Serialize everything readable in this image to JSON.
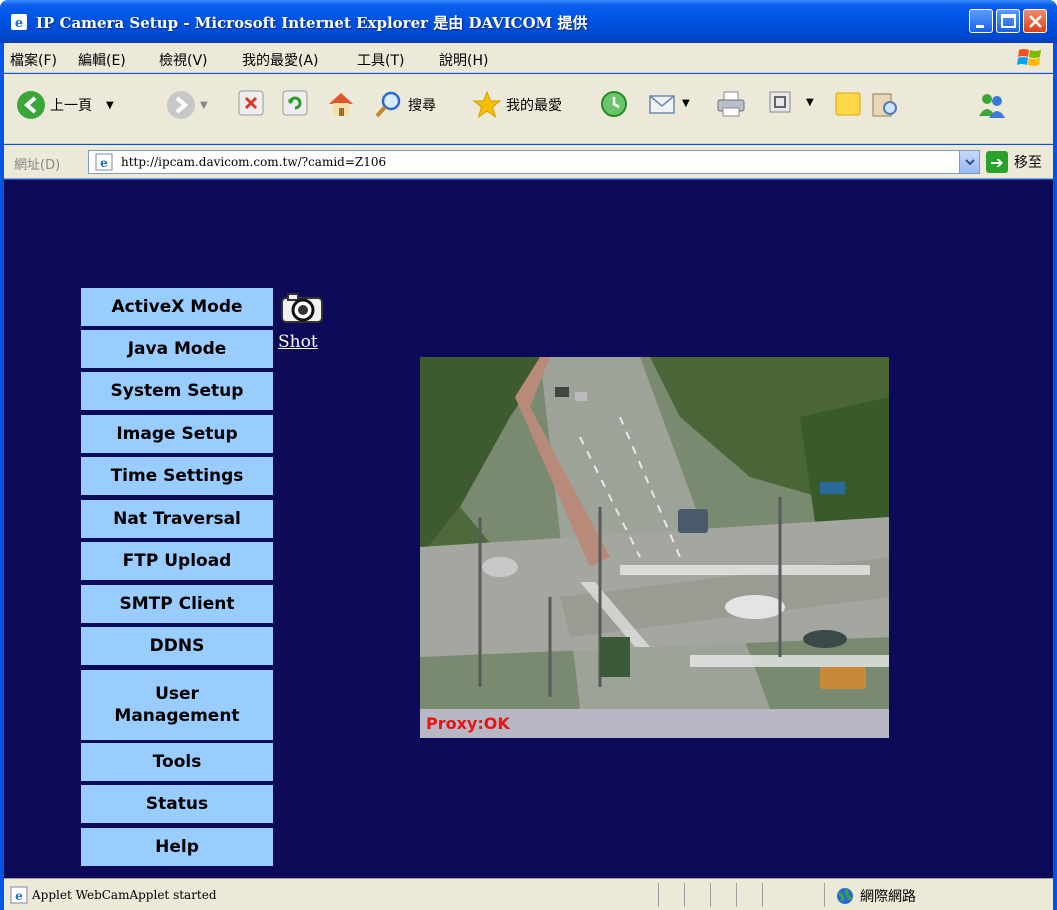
{
  "window": {
    "title": "IP Camera Setup - Microsoft Internet Explorer 是由 DAVICOM  提供"
  },
  "menubar": {
    "items": [
      "檔案(F)",
      "編輯(E)",
      "檢視(V)",
      "我的最愛(A)",
      "工具(T)",
      "說明(H)"
    ]
  },
  "toolbar": {
    "back_label": "上一頁",
    "search_label": "搜尋",
    "favorites_label": "我的最愛"
  },
  "address": {
    "label": "網址(D)",
    "url": "http://ipcam.davicom.com.tw/?camid=Z106",
    "go_label": "移至"
  },
  "nav": {
    "items": [
      "ActiveX Mode",
      "Java Mode",
      "System Setup",
      "Image Setup",
      "Time Settings",
      "Nat Traversal",
      "FTP Upload",
      "SMTP Client",
      "DDNS",
      "User Management",
      "Tools",
      "Status",
      "Help"
    ]
  },
  "shot": {
    "label": "Shot"
  },
  "video": {
    "status": "Proxy:OK"
  },
  "statusbar": {
    "text": "Applet WebCamApplet started",
    "zone": "網際網路"
  },
  "colors": {
    "page_background": "#0e0a5a",
    "menu_button": "#99ccff",
    "proxy_text": "#ee1111"
  }
}
